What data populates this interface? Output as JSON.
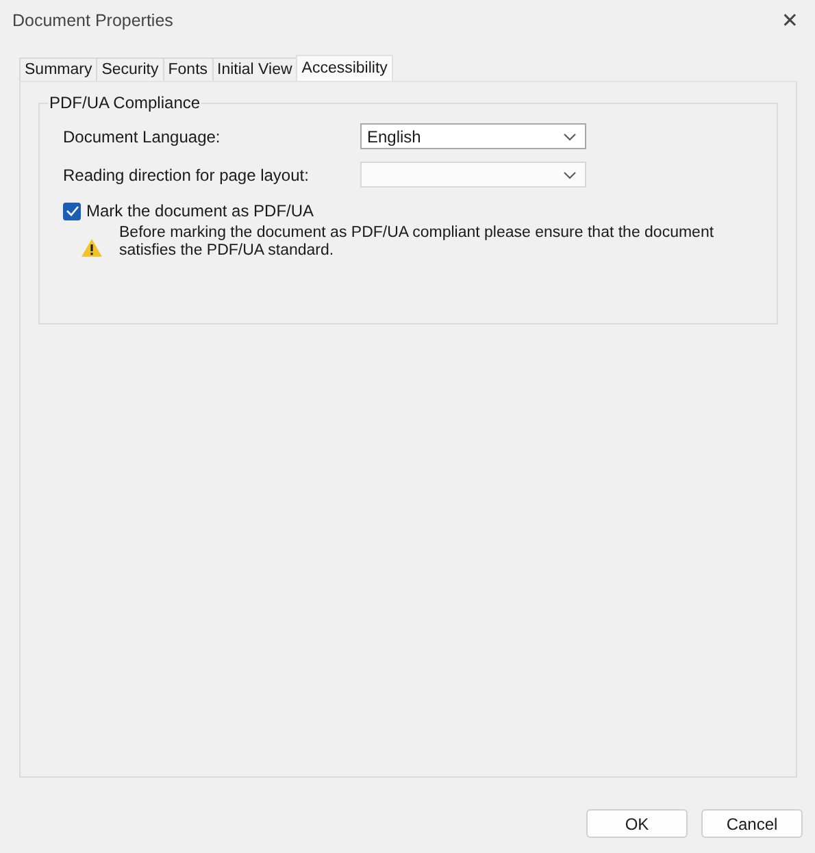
{
  "window": {
    "title": "Document Properties",
    "close": "✕"
  },
  "tabs": [
    {
      "label": "Summary",
      "selected": false
    },
    {
      "label": "Security",
      "selected": false
    },
    {
      "label": "Fonts",
      "selected": false
    },
    {
      "label": "Initial View",
      "selected": false
    },
    {
      "label": "Accessibility",
      "selected": true
    }
  ],
  "group": {
    "title": "PDF/UA Compliance",
    "fields": [
      {
        "label": "Document Language:",
        "value": "English",
        "disabled": false
      },
      {
        "label": "Reading direction for page layout:",
        "disabled": true
      }
    ],
    "checkbox": {
      "label": "Mark the document as PDF/UA",
      "checked": true
    },
    "warning": "Before marking the document as PDF/UA compliant please ensure that the document satisfies the PDF/UA standard."
  },
  "buttons": [
    "OK",
    "Cancel"
  ]
}
